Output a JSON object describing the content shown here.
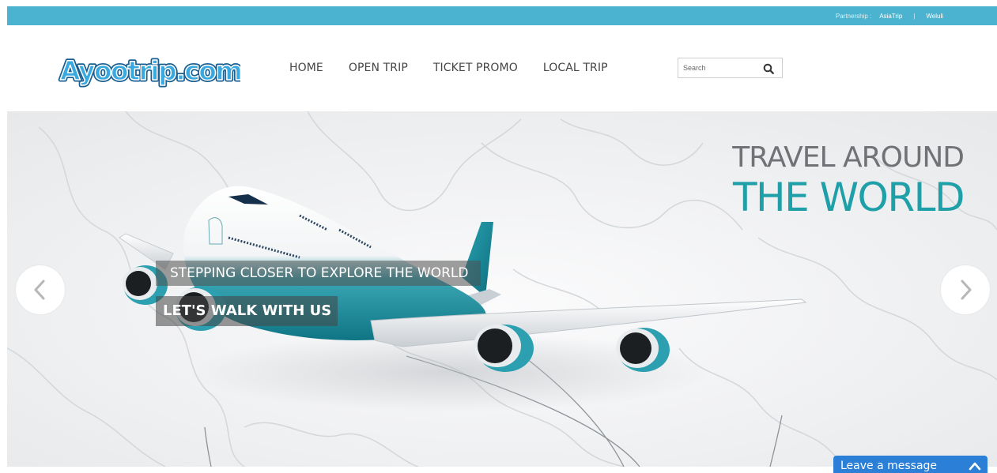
{
  "partners": {
    "label": "Partnership :",
    "links": [
      "AsiaTrip",
      "Weluli"
    ],
    "separator": "|"
  },
  "brand": {
    "logo_text": "Ayootrip.com",
    "logo_color": "#3aa9e0"
  },
  "nav": {
    "items": [
      "HOME",
      "OPEN TRIP",
      "TICKET PROMO",
      "LOCAL TRIP"
    ]
  },
  "search": {
    "placeholder": "Search",
    "icon": "search-icon"
  },
  "hero": {
    "headline_line1": "TRAVEL AROUND",
    "headline_line2": "THE WORLD",
    "caption1": "STEPPING CLOSER TO EXPLORE THE WORLD",
    "caption2": "LET'S WALK WITH US",
    "prev_icon": "chevron-left-icon",
    "next_icon": "chevron-right-icon",
    "accent_color": "#1fa0a8"
  },
  "chat": {
    "label": "Leave a message",
    "icon": "chevron-up-icon",
    "color": "#2c7fd6"
  },
  "colors": {
    "topbar": "#4bb3cf",
    "nav_text": "#444444",
    "headline_gray": "#707276"
  }
}
